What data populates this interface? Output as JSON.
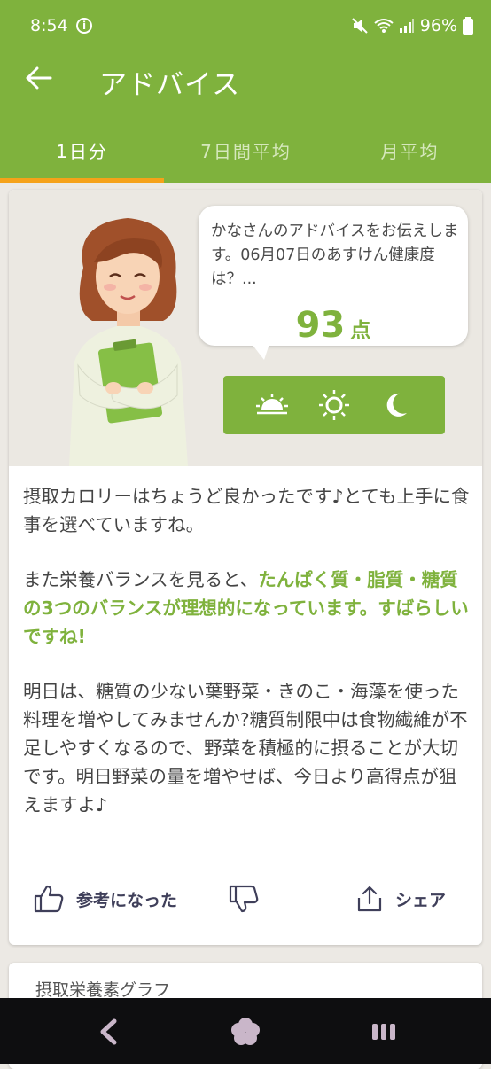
{
  "status_bar": {
    "time": "8:54",
    "battery": "96%"
  },
  "app_bar": {
    "title": "アドバイス"
  },
  "tabs": [
    {
      "label": "1日分",
      "active": true
    },
    {
      "label": "7日間平均",
      "active": false
    },
    {
      "label": "月平均",
      "active": false
    }
  ],
  "bubble": {
    "text": "かなさんのアドバイスをお伝えします。06月07日のあすけん健康度は？...",
    "score": "93",
    "score_unit": "点"
  },
  "time_toggle": [
    "sunrise-icon",
    "sun-icon",
    "moon-icon"
  ],
  "advice": {
    "p1": "摂取カロリーはちょうど良かったです♪とても上手に食事を選べていますね。",
    "p2_plain": "また栄養バランスを見ると、",
    "p2_highlight": "たんぱく質・脂質・糖質の3つのバランスが理想的になっています。すばらしいですね!",
    "p3": "明日は、糖質の少ない葉野菜・きのこ・海藻を使った料理を増やしてみませんか?糖質制限中は食物繊維が不足しやすくなるので、野菜を積極的に摂ることが大切です。明日野菜の量を増やせば、今日より高得点が狙えますよ♪"
  },
  "feedback": {
    "helpful": "参考になった",
    "share": "シェア"
  },
  "section2": {
    "title": "摂取栄養素グラフ"
  },
  "colors": {
    "primary": "#7fb23d",
    "tab_indicator": "#f5a21a",
    "nav_bg": "#0e0e10"
  }
}
